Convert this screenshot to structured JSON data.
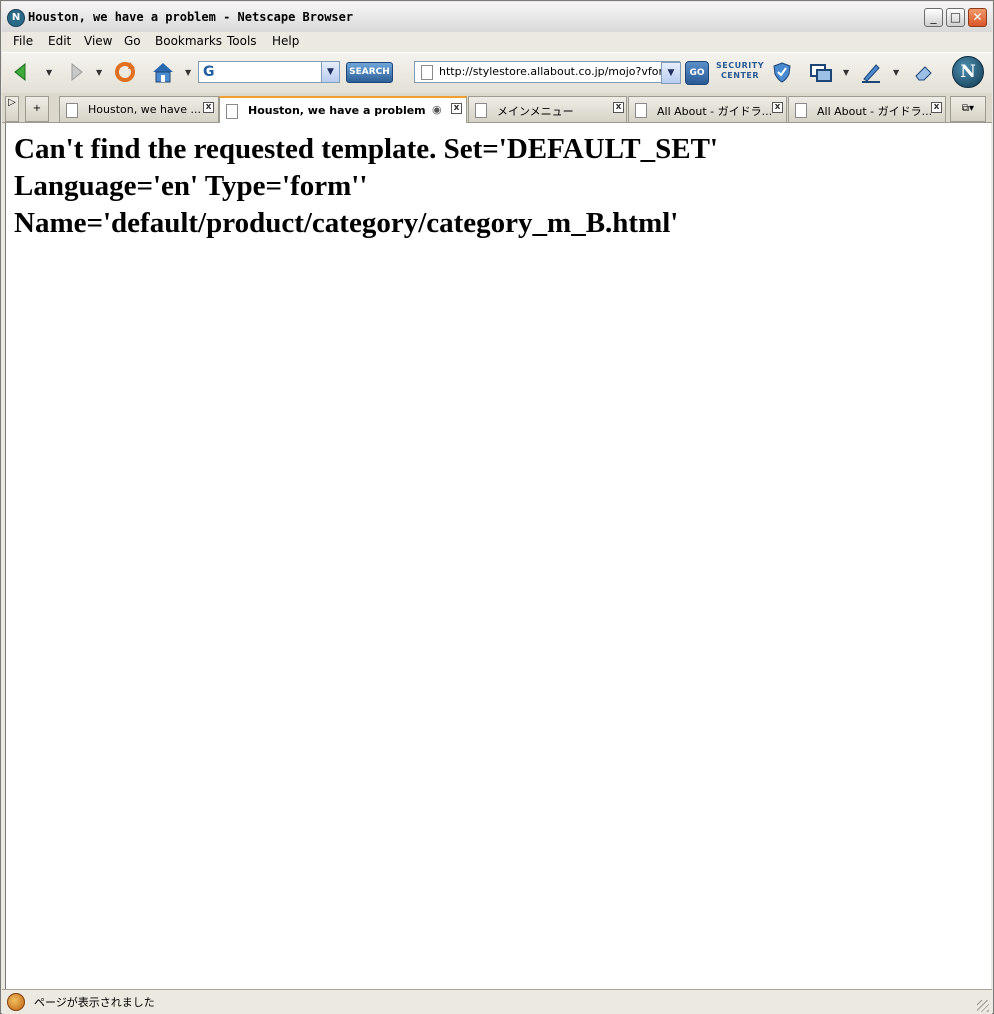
{
  "window": {
    "title": "Houston, we have a problem - Netscape Browser",
    "controls": {
      "minimize": "_",
      "maximize": "□",
      "close": "✕"
    }
  },
  "menubar": {
    "items": [
      "File",
      "Edit",
      "View",
      "Go",
      "Bookmarks",
      "Tools",
      "Help"
    ]
  },
  "toolbar": {
    "search_button": "SEARCH",
    "search_value": "",
    "url": "http://stylestore.allabout.co.jp/mojo?vform",
    "go_button": "GO",
    "security_center_line1": "SECURITY",
    "security_center_line2": "CENTER",
    "icons": [
      "back-icon",
      "forward-icon",
      "reload-icon",
      "home-icon",
      "search-engine-icon",
      "security-shield-icon",
      "window-icon",
      "pen-icon",
      "eraser-icon",
      "netscape-logo-icon"
    ]
  },
  "tabs": {
    "items": [
      {
        "label": "Houston, we have ..."
      },
      {
        "label": "Houston, we have a problem"
      },
      {
        "label": "メインメニュー"
      },
      {
        "label": "All About - ガイドラ..."
      },
      {
        "label": "All About - ガイドラ..."
      }
    ],
    "active_index": 1,
    "new_tab_label": "+"
  },
  "page": {
    "heading": "Can't find the requested template. Set='DEFAULT_SET' Language='en' Type='form'' Name='default/product/category/category_m_B.html'"
  },
  "status": {
    "text": "ページが表示されました"
  },
  "colors": {
    "active_tab_accent": "#f0a030",
    "chrome": "#ece9e0",
    "close_button": "#d9562a"
  }
}
